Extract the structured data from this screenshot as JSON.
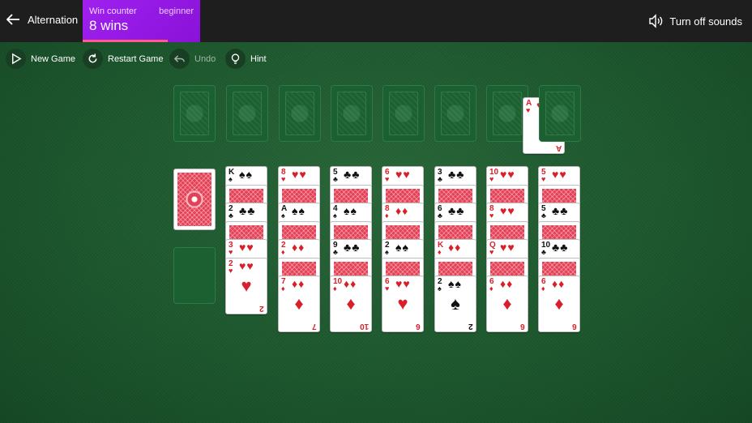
{
  "header": {
    "back_label": "Alternation",
    "win_counter_label": "Win counter",
    "difficulty": "beginner",
    "wins_text": "8 wins",
    "sound_label": "Turn off sounds"
  },
  "toolbar": {
    "new_game": "New Game",
    "restart_game": "Restart Game",
    "undo": "Undo",
    "hint": "Hint"
  },
  "colors": {
    "accent": "#a020f0",
    "felt": "#1f5a30",
    "card_red": "#d9202a",
    "back_red": "#e54055"
  },
  "foundations": [
    {
      "card": null
    },
    {
      "card": null
    },
    {
      "card": null
    },
    {
      "card": null
    },
    {
      "card": null
    },
    {
      "card": null
    },
    {
      "card": {
        "rank": "A",
        "suit": "♥"
      }
    },
    {
      "card": null
    }
  ],
  "stock": {
    "face_down": true
  },
  "tableau": [
    {
      "cards": [
        {
          "rank": "K",
          "suit": "♠"
        },
        {
          "back": true
        },
        {
          "rank": "2",
          "suit": "♣"
        },
        {
          "back": true
        },
        {
          "rank": "3",
          "suit": "♥"
        },
        {
          "rank": "2",
          "suit": "♥"
        }
      ]
    },
    {
      "cards": [
        {
          "rank": "8",
          "suit": "♥"
        },
        {
          "back": true
        },
        {
          "rank": "A",
          "suit": "♠"
        },
        {
          "back": true
        },
        {
          "rank": "2",
          "suit": "♦"
        },
        {
          "back": true
        },
        {
          "rank": "7",
          "suit": "♦"
        }
      ]
    },
    {
      "cards": [
        {
          "rank": "5",
          "suit": "♣"
        },
        {
          "back": true
        },
        {
          "rank": "4",
          "suit": "♠"
        },
        {
          "back": true
        },
        {
          "rank": "9",
          "suit": "♣"
        },
        {
          "back": true
        },
        {
          "rank": "10",
          "suit": "♦"
        }
      ]
    },
    {
      "cards": [
        {
          "rank": "6",
          "suit": "♥"
        },
        {
          "back": true
        },
        {
          "rank": "8",
          "suit": "♦"
        },
        {
          "back": true
        },
        {
          "rank": "2",
          "suit": "♠"
        },
        {
          "back": true
        },
        {
          "rank": "6",
          "suit": "♥"
        }
      ]
    },
    {
      "cards": [
        {
          "rank": "3",
          "suit": "♣"
        },
        {
          "back": true
        },
        {
          "rank": "6",
          "suit": "♣"
        },
        {
          "back": true
        },
        {
          "rank": "K",
          "suit": "♦"
        },
        {
          "back": true
        },
        {
          "rank": "2",
          "suit": "♠"
        }
      ]
    },
    {
      "cards": [
        {
          "rank": "10",
          "suit": "♥"
        },
        {
          "back": true
        },
        {
          "rank": "8",
          "suit": "♥"
        },
        {
          "back": true
        },
        {
          "rank": "Q",
          "suit": "♥"
        },
        {
          "back": true
        },
        {
          "rank": "6",
          "suit": "♦"
        }
      ]
    },
    {
      "cards": [
        {
          "rank": "5",
          "suit": "♥"
        },
        {
          "back": true
        },
        {
          "rank": "5",
          "suit": "♣"
        },
        {
          "back": true
        },
        {
          "rank": "10",
          "suit": "♣"
        },
        {
          "back": true
        },
        {
          "rank": "6",
          "suit": "♦"
        }
      ]
    }
  ]
}
